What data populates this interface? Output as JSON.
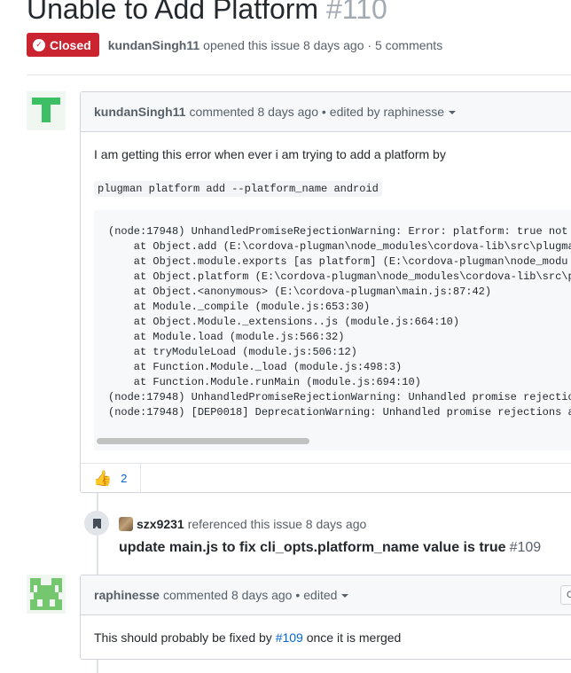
{
  "issue": {
    "title": "Unable to Add Platform",
    "number": "#110",
    "state": "Closed",
    "author": "kundanSingh11",
    "opened_text": "opened this issue 8 days ago · 5 comments"
  },
  "comment1": {
    "author": "kundanSingh11",
    "action": "commented 8 days ago •",
    "edited": "edited by raphinesse",
    "text": "I am getting this error when ever i am trying to add a platform by",
    "command": "plugman platform add --platform_name android",
    "code": "(node:17948) UnhandledPromiseRejectionWarning: Error: platform: true not\n    at Object.add (E:\\cordova-plugman\\node_modules\\cordova-lib\\src\\plugma\n    at Object.module.exports [as platform] (E:\\cordova-plugman\\node_modu\n    at Object.platform (E:\\cordova-plugman\\node_modules\\cordova-lib\\src\\p\n    at Object.<anonymous> (E:\\cordova-plugman\\main.js:87:42)\n    at Module._compile (module.js:653:30)\n    at Object.Module._extensions..js (module.js:664:10)\n    at Module.load (module.js:566:32)\n    at tryModuleLoad (module.js:506:12)\n    at Function.Module._load (module.js:498:3)\n    at Function.Module.runMain (module.js:694:10)\n(node:17948) UnhandledPromiseRejectionWarning: Unhandled promise rejectio\n(node:17948) [DEP0018] DeprecationWarning: Unhandled promise rejections a",
    "reaction_emoji": "👍",
    "reaction_count": "2"
  },
  "reference": {
    "user": "szx9231",
    "text": "referenced this issue 8 days ago",
    "title": "update main.js to fix cli_opts.platform_name value is true",
    "number": "#109"
  },
  "comment2": {
    "author": "raphinesse",
    "action": "commented 8 days ago •",
    "edited": "edited",
    "button_glyph": "C",
    "text_before": "This should probably be fixed by",
    "link": "#109",
    "text_after": "once it is merged"
  }
}
